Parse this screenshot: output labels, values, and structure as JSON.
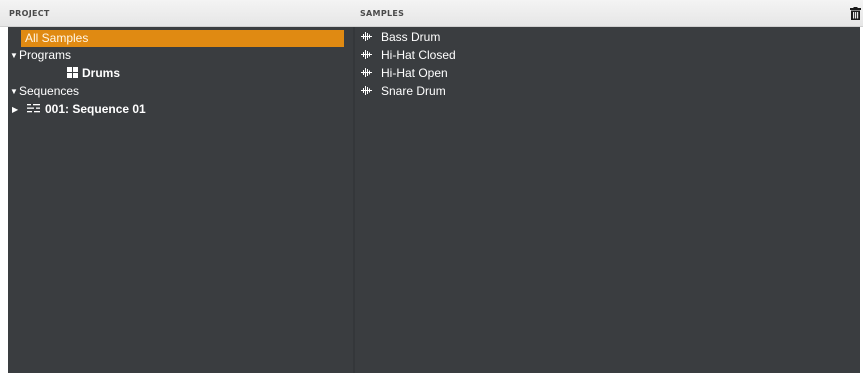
{
  "header": {
    "project_label": "PROJECT",
    "samples_label": "SAMPLES",
    "trash_icon": "trash-icon"
  },
  "project_tree": {
    "all_samples": "All Samples",
    "programs": {
      "label": "Programs",
      "expanded": true,
      "items": [
        {
          "label": "Drums",
          "icon": "grid-icon"
        }
      ]
    },
    "sequences": {
      "label": "Sequences",
      "expanded": true,
      "items": [
        {
          "label": "001: Sequence 01",
          "icon": "sequence-icon",
          "expanded": false
        }
      ]
    }
  },
  "samples": [
    {
      "label": "Bass Drum",
      "icon": "waveform-icon"
    },
    {
      "label": "Hi-Hat Closed",
      "icon": "waveform-icon"
    },
    {
      "label": "Hi-Hat Open",
      "icon": "waveform-icon"
    },
    {
      "label": "Snare Drum",
      "icon": "waveform-icon"
    }
  ],
  "colors": {
    "panel_bg": "#3a3d40",
    "selection": "#e08a12",
    "header_bg": "#ececec",
    "text": "#ffffff"
  }
}
